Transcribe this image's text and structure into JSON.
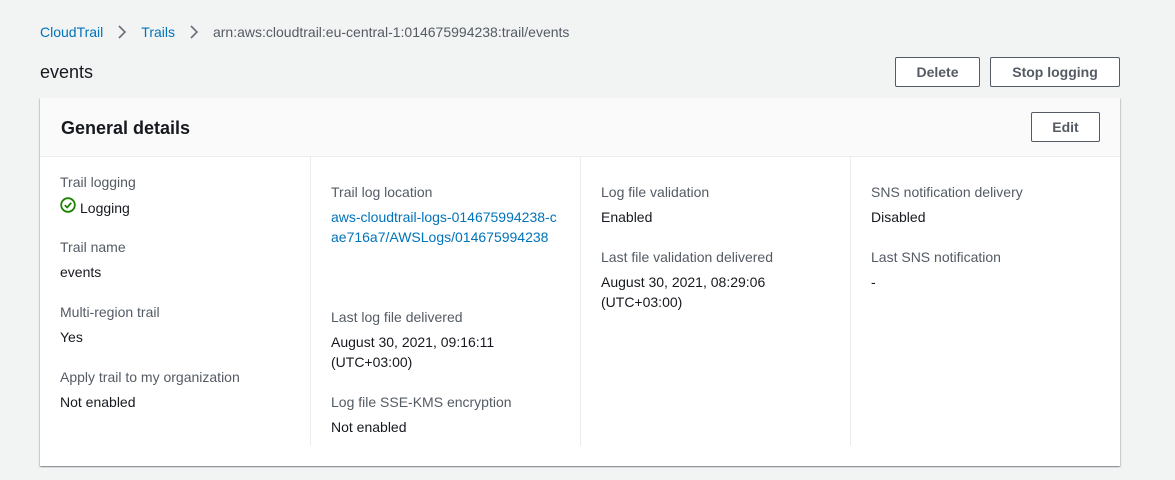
{
  "breadcrumb": {
    "items": [
      "CloudTrail",
      "Trails"
    ],
    "current": "arn:aws:cloudtrail:eu-central-1:014675994238:trail/events"
  },
  "page": {
    "title": "events",
    "delete_label": "Delete",
    "stop_logging_label": "Stop logging"
  },
  "panel": {
    "title": "General details",
    "edit_label": "Edit",
    "col1": {
      "trail_logging_label": "Trail logging",
      "trail_logging_value": "Logging",
      "trail_name_label": "Trail name",
      "trail_name_value": "events",
      "multi_region_label": "Multi-region trail",
      "multi_region_value": "Yes",
      "apply_org_label": "Apply trail to my organization",
      "apply_org_value": "Not enabled"
    },
    "col2": {
      "log_location_label": "Trail log location",
      "log_location_value": "aws-cloudtrail-logs-014675994238-cae716a7/AWSLogs/014675994238",
      "last_log_label": "Last log file delivered",
      "last_log_value": "August 30, 2021, 09:16:11 (UTC+03:00)",
      "sse_kms_label": "Log file SSE-KMS encryption",
      "sse_kms_value": "Not enabled"
    },
    "col3": {
      "validation_label": "Log file validation",
      "validation_value": "Enabled",
      "last_validation_label": "Last file validation delivered",
      "last_validation_value": "August 30, 2021, 08:29:06 (UTC+03:00)"
    },
    "col4": {
      "sns_label": "SNS notification delivery",
      "sns_value": "Disabled",
      "last_sns_label": "Last SNS notification",
      "last_sns_value": "-"
    }
  },
  "colors": {
    "link": "#0073bb",
    "success": "#1d8102",
    "background": "#f2f3f3"
  }
}
